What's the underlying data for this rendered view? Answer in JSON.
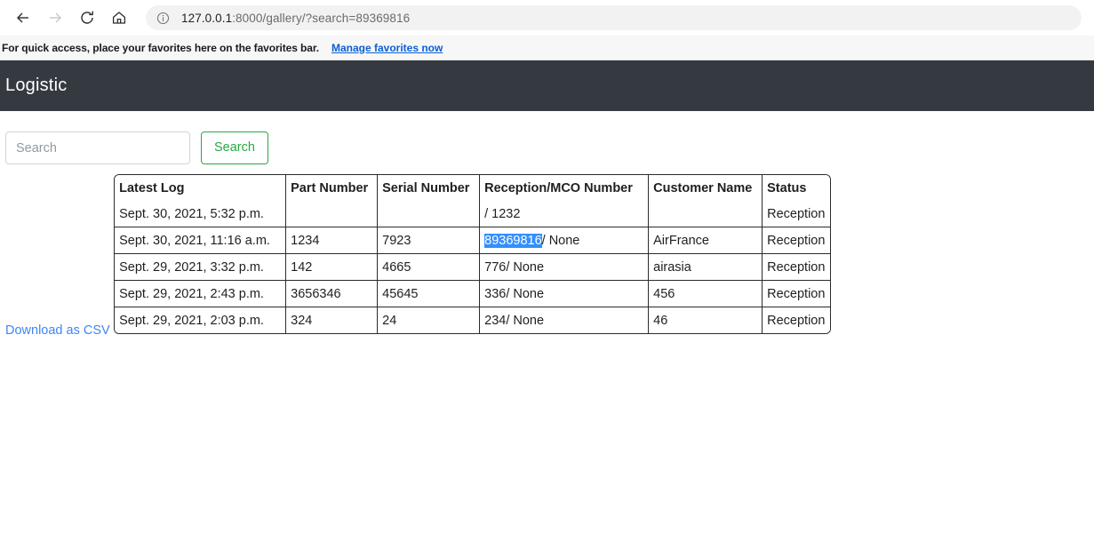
{
  "browser": {
    "back_icon": "back-arrow-icon",
    "forward_icon": "forward-arrow-icon",
    "reload_icon": "reload-icon",
    "home_icon": "home-icon",
    "info_icon": "info-icon",
    "url_host": "127.0.0.1",
    "url_rest": ":8000/gallery/?search=89369816",
    "favorites_text": "For quick access, place your favorites here on the favorites bar.",
    "favorites_link": "Manage favorites now",
    "link_color": "#0a5fd4"
  },
  "navbar": {
    "brand": "Logistic",
    "background": "#343a40"
  },
  "search": {
    "placeholder": "Search",
    "value": "",
    "button_label": "Search",
    "button_color": "#28a745"
  },
  "actions": {
    "csv_label": "Download as CSV",
    "csv_color": "#3e86f5"
  },
  "table": {
    "headers": [
      "Latest Log",
      "Part Number",
      "Serial Number",
      "Reception/MCO Number",
      "Customer Name",
      "Status"
    ],
    "rows": [
      {
        "latest_log": "Sept. 30, 2021, 5:32 p.m.",
        "part_number": "",
        "serial_number": "",
        "reception_selected": "",
        "reception_rest": "/ 1232",
        "customer_name": "",
        "status": "Reception"
      },
      {
        "latest_log": "Sept. 30, 2021, 11:16 a.m.",
        "part_number": "1234",
        "serial_number": "7923",
        "reception_selected": "89369816",
        "reception_rest": "/ None",
        "customer_name": "AirFrance",
        "status": "Reception"
      },
      {
        "latest_log": "Sept. 29, 2021, 3:32 p.m.",
        "part_number": "142",
        "serial_number": "4665",
        "reception_selected": "",
        "reception_rest": "776/ None",
        "customer_name": "airasia",
        "status": "Reception"
      },
      {
        "latest_log": "Sept. 29, 2021, 2:43 p.m.",
        "part_number": "3656346",
        "serial_number": "45645",
        "reception_selected": "",
        "reception_rest": "336/ None",
        "customer_name": "456",
        "status": "Reception"
      },
      {
        "latest_log": "Sept. 29, 2021, 2:03 p.m.",
        "part_number": "324",
        "serial_number": "24",
        "reception_selected": "",
        "reception_rest": "234/ None",
        "customer_name": "46",
        "status": "Reception"
      }
    ],
    "selection_color": "#338fff"
  }
}
